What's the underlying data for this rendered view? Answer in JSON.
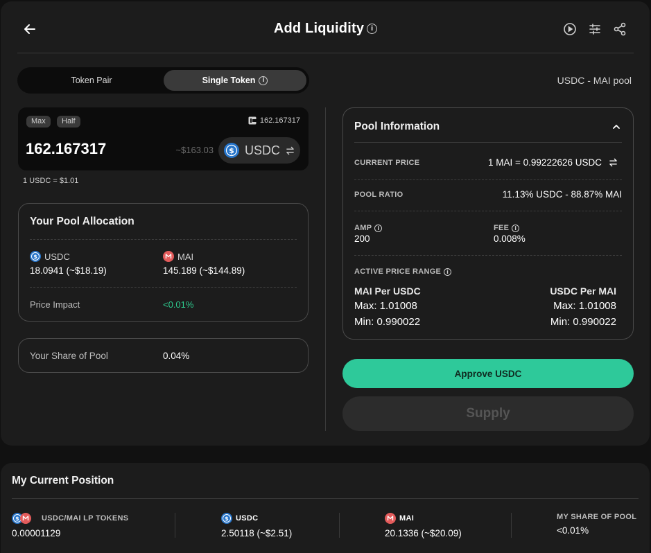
{
  "header": {
    "title": "Add Liquidity",
    "icons": [
      "arrow-left-icon",
      "info-icon",
      "play-circle-icon",
      "sliders-icon",
      "share-icon"
    ]
  },
  "mode_toggle": {
    "options": [
      "Token Pair",
      "Single Token"
    ],
    "selected": "Single Token"
  },
  "pool_name": "USDC - MAI pool",
  "input": {
    "max_label": "Max",
    "half_label": "Half",
    "balance": "162.167317",
    "amount": "162.167317",
    "usd_estimate": "~$163.03",
    "token": "USDC",
    "rate_note": "1 USDC = $1.01"
  },
  "allocation": {
    "title": "Your Pool Allocation",
    "tokens": [
      {
        "symbol": "USDC",
        "value": "18.0941 (~$18.19)"
      },
      {
        "symbol": "MAI",
        "value": "145.189 (~$144.89)"
      }
    ],
    "price_impact_label": "Price Impact",
    "price_impact_value": "<0.01%"
  },
  "share": {
    "label": "Your Share of Pool",
    "value": "0.04%"
  },
  "pool_info": {
    "title": "Pool Information",
    "current_price_label": "CURRENT PRICE",
    "current_price_value": "1 MAI = 0.99222626 USDC",
    "pool_ratio_label": "POOL RATIO",
    "pool_ratio_value": "11.13% USDC - 88.87% MAI",
    "amp_label": "AMP",
    "amp_value": "200",
    "fee_label": "FEE",
    "fee_value": "0.008%",
    "range_label": "ACTIVE PRICE RANGE",
    "left_head": "MAI Per USDC",
    "left_max": "Max: 1.01008",
    "left_min": "Min: 0.990022",
    "right_head": "USDC Per MAI",
    "right_max": "Max: 1.01008",
    "right_min": "Min: 0.990022"
  },
  "actions": {
    "approve_label": "Approve USDC",
    "supply_label": "Supply"
  },
  "position": {
    "title": "My Current Position",
    "lp_label": "USDC/MAI LP TOKENS",
    "lp_value": "0.00001129",
    "usdc_label": "USDC",
    "usdc_value": "2.50118 (~$2.51)",
    "mai_label": "MAI",
    "mai_value": "20.1336 (~$20.09)",
    "share_label": "MY SHARE OF POOL",
    "share_value": "<0.01%"
  },
  "colors": {
    "background": "#111111",
    "card": "#1c1c1c",
    "accent_green": "#2ec99a",
    "positive_text": "#2ecc8f",
    "usdc_blue": "#2775ca",
    "mai_red": "#e35b5b"
  }
}
